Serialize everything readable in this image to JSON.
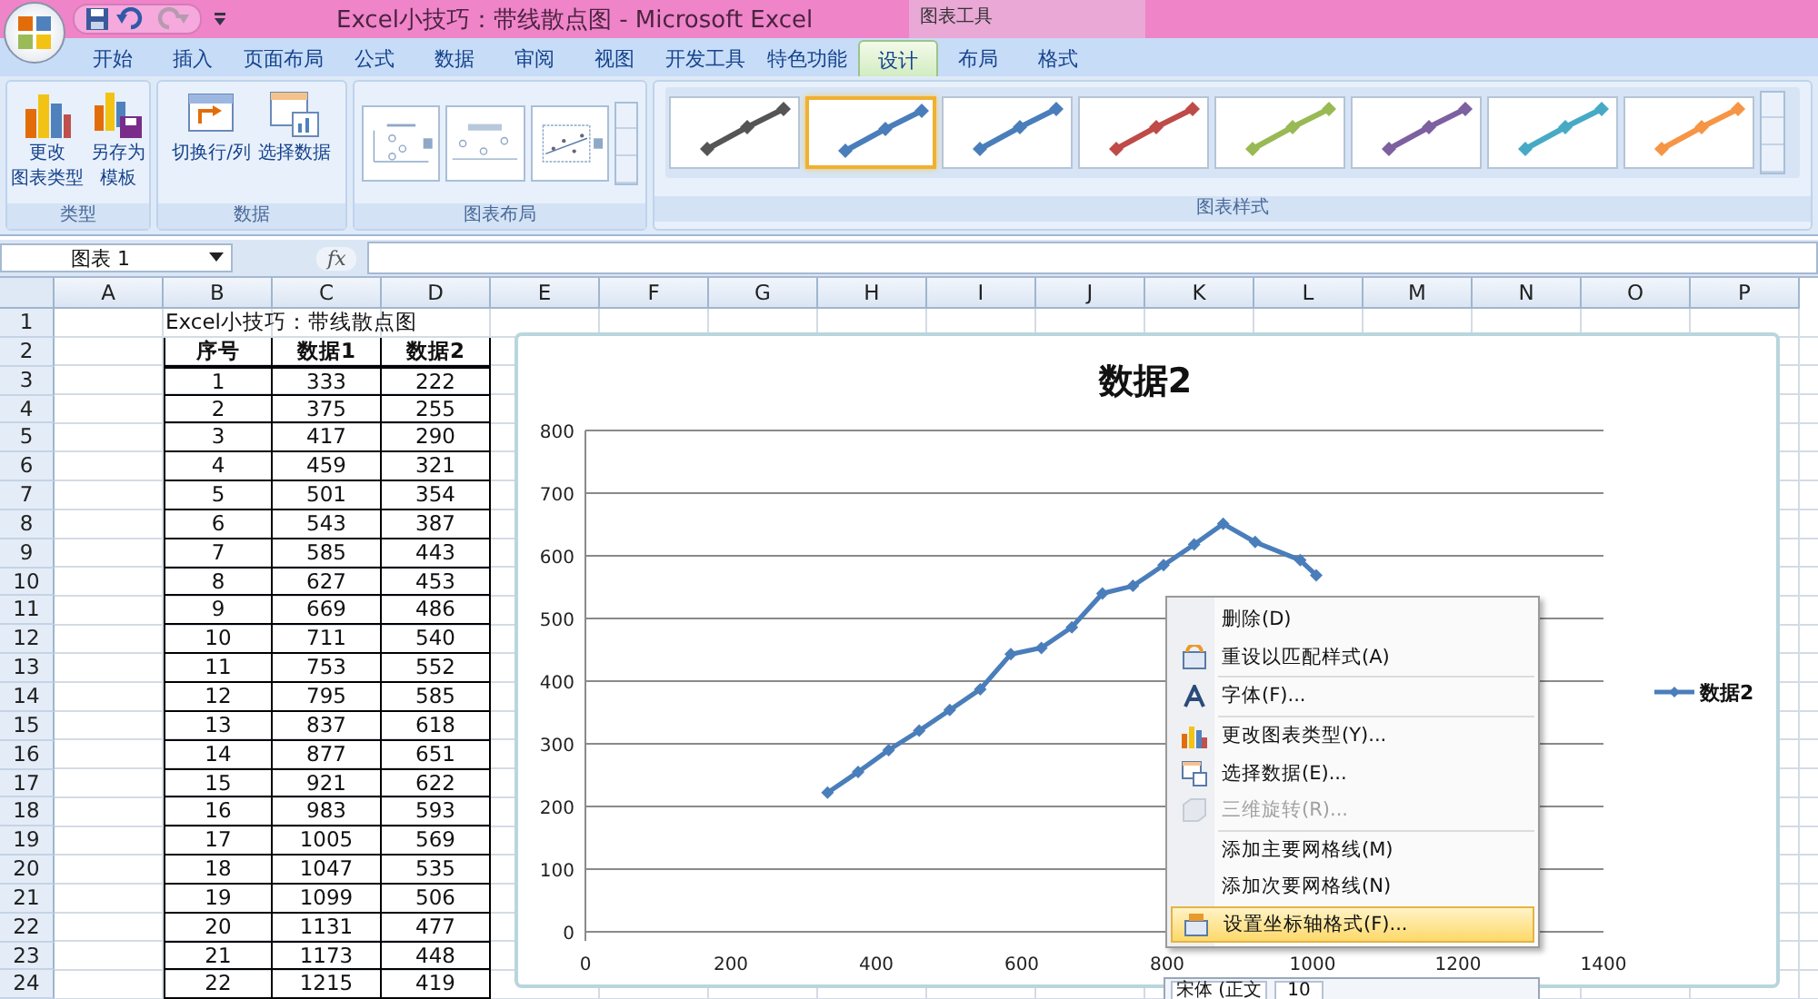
{
  "window": {
    "title": "Excel小技巧：带线散点图 - Microsoft Excel",
    "contextual_group": "图表工具"
  },
  "tabs": [
    {
      "label": "开始",
      "selected": false
    },
    {
      "label": "插入",
      "selected": false
    },
    {
      "label": "页面布局",
      "selected": false
    },
    {
      "label": "公式",
      "selected": false
    },
    {
      "label": "数据",
      "selected": false
    },
    {
      "label": "审阅",
      "selected": false
    },
    {
      "label": "视图",
      "selected": false
    },
    {
      "label": "开发工具",
      "selected": false
    },
    {
      "label": "特色功能",
      "selected": false
    },
    {
      "label": "设计",
      "selected": true
    },
    {
      "label": "布局",
      "selected": false
    },
    {
      "label": "格式",
      "selected": false
    }
  ],
  "ribbon": {
    "type_group": {
      "label": "类型",
      "buttons": [
        {
          "label_lines": [
            "更改",
            "图表类型"
          ],
          "kind": "chart"
        },
        {
          "label_lines": [
            "另存为",
            "模板"
          ],
          "kind": "save"
        }
      ]
    },
    "data_group": {
      "label": "数据",
      "buttons": [
        {
          "label": "切换行/列",
          "kind": "switch"
        },
        {
          "label": "选择数据",
          "kind": "select"
        }
      ]
    },
    "layout_group": {
      "label": "图表布局"
    },
    "styles_group": {
      "label": "图表样式",
      "styles": [
        {
          "color": "#555555",
          "selected": false
        },
        {
          "color": "#4a7ebb",
          "selected": true
        },
        {
          "color": "#4a7ebb",
          "selected": false
        },
        {
          "color": "#be4b48",
          "selected": false
        },
        {
          "color": "#98b954",
          "selected": false
        },
        {
          "color": "#7d60a0",
          "selected": false
        },
        {
          "color": "#46aac5",
          "selected": false
        },
        {
          "color": "#f69545",
          "selected": false
        }
      ]
    }
  },
  "formula_bar": {
    "name_box": "图表 1",
    "fx": "fx"
  },
  "sheet": {
    "columns": [
      "A",
      "B",
      "C",
      "D",
      "E",
      "F",
      "G",
      "H",
      "I",
      "J",
      "K",
      "L",
      "M",
      "N",
      "O",
      "P"
    ],
    "rows": [
      {
        "header": "1",
        "kind": "title",
        "values": [
          "Excel小技巧：带线散点图"
        ]
      },
      {
        "header": "2",
        "kind": "header",
        "values": [
          "序号",
          "数据1",
          "数据2"
        ]
      },
      {
        "header": "3",
        "kind": "data",
        "values": [
          "1",
          "333",
          "222"
        ]
      },
      {
        "header": "4",
        "kind": "data",
        "values": [
          "2",
          "375",
          "255"
        ]
      },
      {
        "header": "5",
        "kind": "data",
        "values": [
          "3",
          "417",
          "290"
        ]
      },
      {
        "header": "6",
        "kind": "data",
        "values": [
          "4",
          "459",
          "321"
        ]
      },
      {
        "header": "7",
        "kind": "data",
        "values": [
          "5",
          "501",
          "354"
        ]
      },
      {
        "header": "8",
        "kind": "data",
        "values": [
          "6",
          "543",
          "387"
        ]
      },
      {
        "header": "9",
        "kind": "data",
        "values": [
          "7",
          "585",
          "443"
        ]
      },
      {
        "header": "10",
        "kind": "data",
        "values": [
          "8",
          "627",
          "453"
        ]
      },
      {
        "header": "11",
        "kind": "data",
        "values": [
          "9",
          "669",
          "486"
        ]
      },
      {
        "header": "12",
        "kind": "data",
        "values": [
          "10",
          "711",
          "540"
        ]
      },
      {
        "header": "13",
        "kind": "data",
        "values": [
          "11",
          "753",
          "552"
        ]
      },
      {
        "header": "14",
        "kind": "data",
        "values": [
          "12",
          "795",
          "585"
        ]
      },
      {
        "header": "15",
        "kind": "data",
        "values": [
          "13",
          "837",
          "618"
        ]
      },
      {
        "header": "16",
        "kind": "data",
        "values": [
          "14",
          "877",
          "651"
        ]
      },
      {
        "header": "17",
        "kind": "data",
        "values": [
          "15",
          "921",
          "622"
        ]
      },
      {
        "header": "18",
        "kind": "data",
        "values": [
          "16",
          "983",
          "593"
        ]
      },
      {
        "header": "19",
        "kind": "data",
        "values": [
          "17",
          "1005",
          "569"
        ]
      },
      {
        "header": "20",
        "kind": "data",
        "values": [
          "18",
          "1047",
          "535"
        ]
      },
      {
        "header": "21",
        "kind": "data",
        "values": [
          "19",
          "1099",
          "506"
        ]
      },
      {
        "header": "22",
        "kind": "data",
        "values": [
          "20",
          "1131",
          "477"
        ]
      },
      {
        "header": "23",
        "kind": "data",
        "values": [
          "21",
          "1173",
          "448"
        ]
      },
      {
        "header": "24",
        "kind": "data",
        "values": [
          "22",
          "1215",
          "419"
        ]
      }
    ]
  },
  "chart": {
    "chart_data": {
      "type": "line",
      "title": "数据2",
      "grid": true,
      "x": [
        333,
        375,
        417,
        459,
        501,
        543,
        585,
        627,
        669,
        711,
        753,
        795,
        837,
        877,
        921,
        983,
        1005
      ],
      "series": [
        {
          "name": "数据2",
          "color": "#4a7ebb",
          "marker": "diamond",
          "values": [
            222,
            255,
            290,
            321,
            354,
            387,
            443,
            453,
            486,
            540,
            552,
            585,
            618,
            651,
            622,
            593,
            569
          ]
        }
      ],
      "xlim": [
        0,
        1400
      ],
      "ylim": [
        0,
        800
      ],
      "xticks": [
        0,
        200,
        400,
        600,
        800,
        1000,
        1200,
        1400
      ],
      "yticks": [
        0,
        100,
        200,
        300,
        400,
        500,
        600,
        700,
        800
      ]
    }
  },
  "context_menu": {
    "items": [
      {
        "label": "删除(D)",
        "kind": "plain",
        "disabled": false,
        "selected": false,
        "group_start": false
      },
      {
        "label": "重设以匹配样式(A)",
        "kind": "reset",
        "disabled": false,
        "selected": false,
        "group_start": false
      },
      {
        "label": "字体(F)...",
        "kind": "font",
        "disabled": false,
        "selected": false,
        "group_start": true
      },
      {
        "label": "更改图表类型(Y)...",
        "kind": "chart",
        "disabled": false,
        "selected": false,
        "group_start": true
      },
      {
        "label": "选择数据(E)...",
        "kind": "data",
        "disabled": false,
        "selected": false,
        "group_start": false
      },
      {
        "label": "三维旋转(R)...",
        "kind": "rotate",
        "disabled": true,
        "selected": false,
        "group_start": false
      },
      {
        "label": "添加主要网格线(M)",
        "kind": "plain",
        "disabled": false,
        "selected": false,
        "group_start": true
      },
      {
        "label": "添加次要网格线(N)",
        "kind": "plain",
        "disabled": false,
        "selected": false,
        "group_start": false
      },
      {
        "label": "设置坐标轴格式(F)...",
        "kind": "format",
        "disabled": false,
        "selected": true,
        "group_start": false
      }
    ]
  },
  "mini_toolbar": {
    "font": "宋体 (正文",
    "size": "10"
  }
}
